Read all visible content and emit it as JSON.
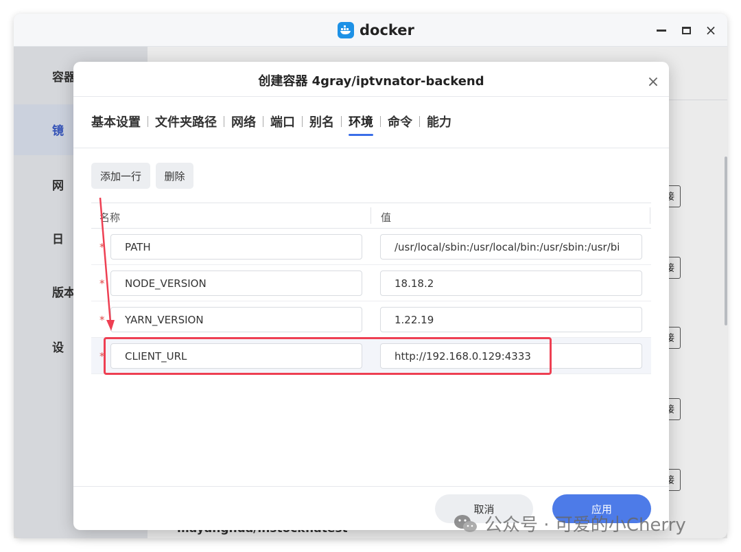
{
  "app": {
    "title": "docker",
    "window_controls": {
      "minimize": "minimize",
      "maximize": "maximize",
      "close": "×"
    }
  },
  "background": {
    "sidebar_items": [
      "容器",
      "镜",
      "网",
      "日",
      "版本",
      "设"
    ],
    "connect_label": "连接",
    "bottom_text": "mayanghua/instock:latest"
  },
  "modal": {
    "title": "创建容器 4gray/iptvnator-backend",
    "close": "×",
    "tabs": [
      {
        "label": "基本设置",
        "active": false
      },
      {
        "label": "文件夹路径",
        "active": false
      },
      {
        "label": "网络",
        "active": false
      },
      {
        "label": "端口",
        "active": false
      },
      {
        "label": "别名",
        "active": false
      },
      {
        "label": "环境",
        "active": true
      },
      {
        "label": "命令",
        "active": false
      },
      {
        "label": "能力",
        "active": false
      }
    ],
    "toolbar": {
      "add_row": "添加一行",
      "delete": "删除"
    },
    "table": {
      "headers": {
        "name": "名称",
        "value": "值"
      },
      "required_mark": "*",
      "rows": [
        {
          "name": "PATH",
          "value": "/usr/local/sbin:/usr/local/bin:/usr/sbin:/usr/bi"
        },
        {
          "name": "NODE_VERSION",
          "value": "18.18.2"
        },
        {
          "name": "YARN_VERSION",
          "value": "1.22.19"
        },
        {
          "name": "CLIENT_URL",
          "value": "http://192.168.0.129:4333"
        }
      ]
    },
    "footer": {
      "cancel": "取消",
      "apply": "应用"
    }
  },
  "watermark": "公众号 · 可爱的小Cherry",
  "colors": {
    "accent": "#4d7be8",
    "annotation": "#ee3f52",
    "required": "#e04848"
  }
}
